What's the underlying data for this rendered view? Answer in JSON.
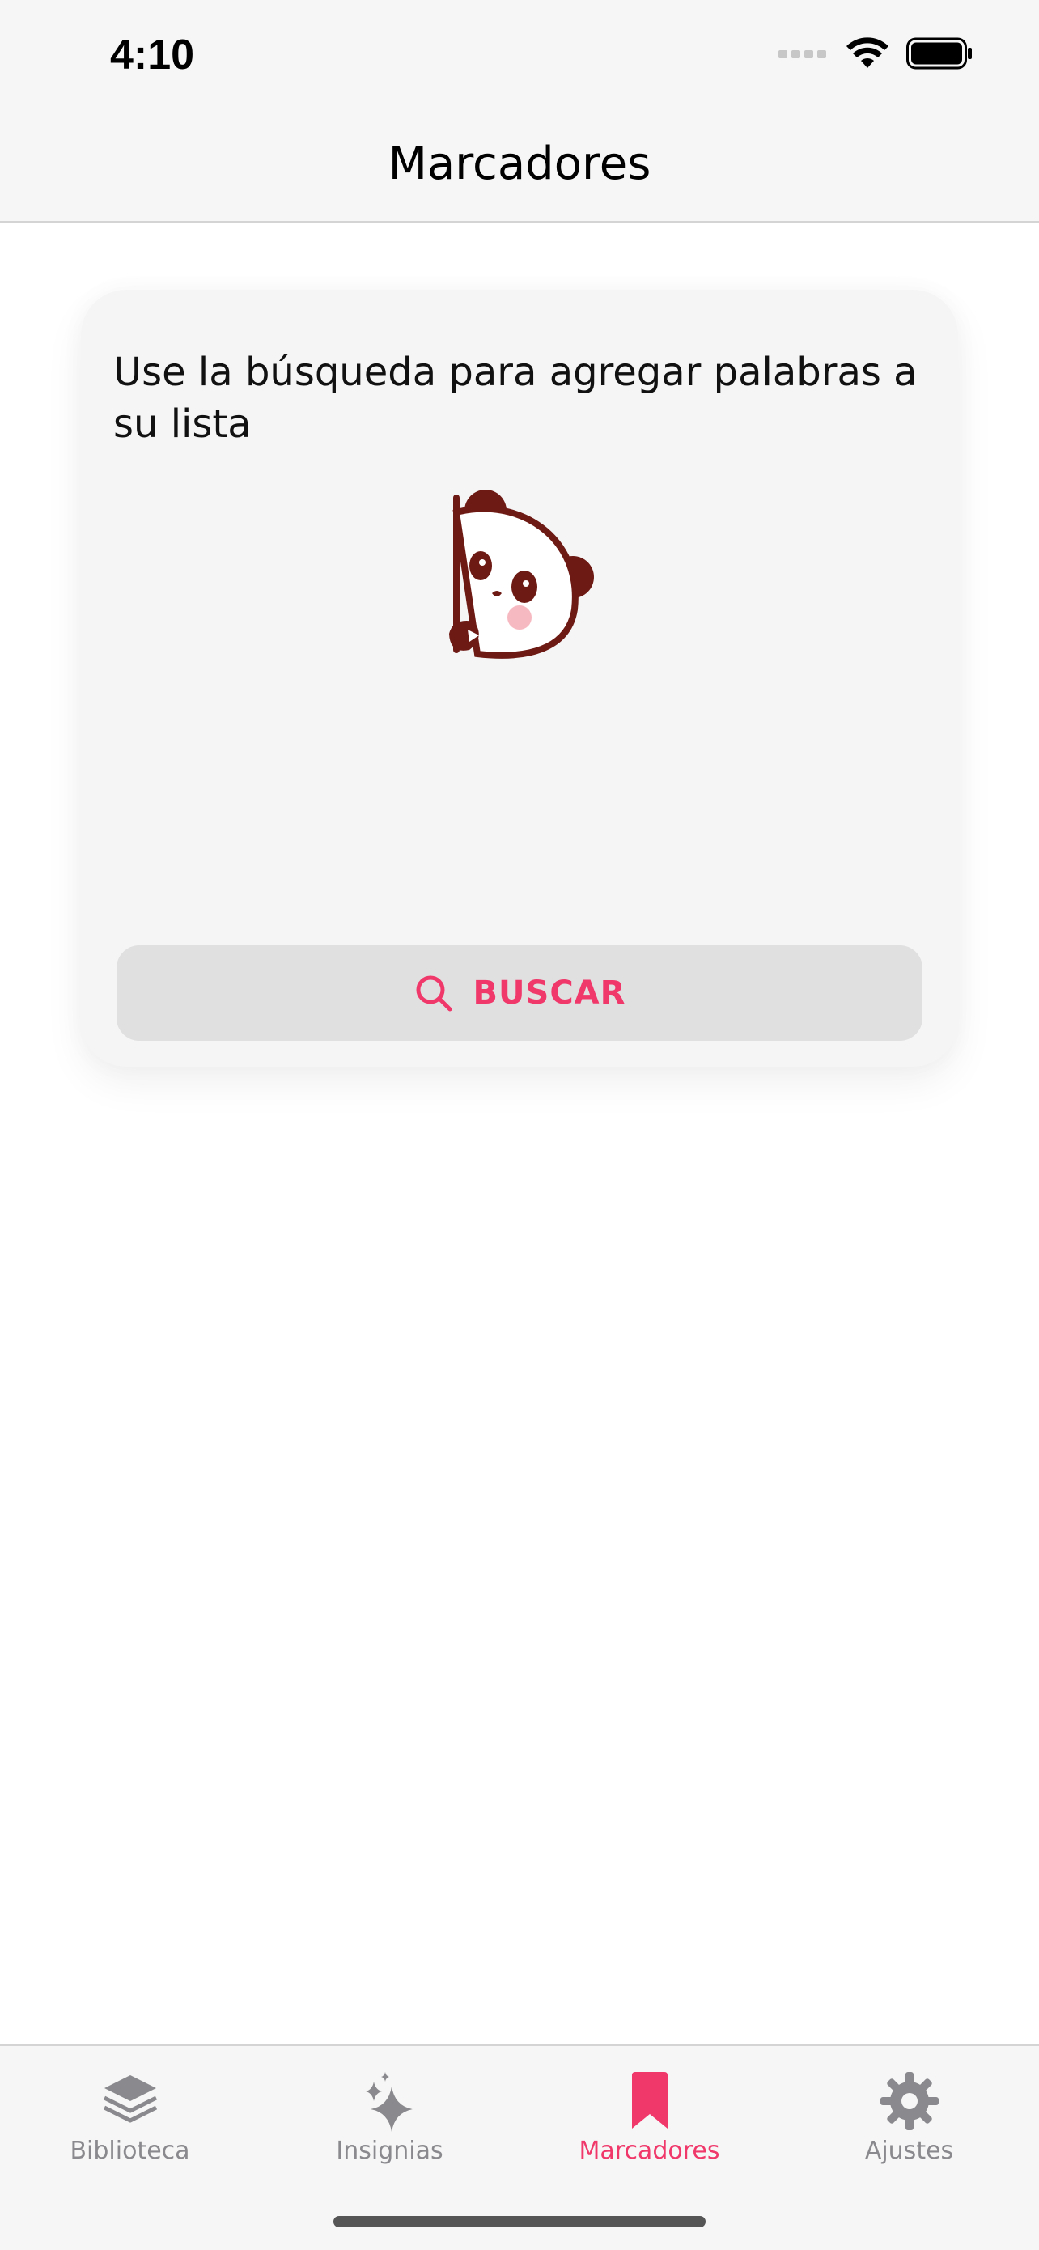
{
  "status_bar": {
    "time": "4:10"
  },
  "nav": {
    "title": "Marcadores"
  },
  "card": {
    "message": "Use la búsqueda para agregar palabras a su lista",
    "search_button_label": "BUSCAR",
    "search_icon": "search-icon",
    "illustration": "panda-peeking"
  },
  "tabs": [
    {
      "label": "Biblioteca",
      "icon": "stack-icon",
      "active": false
    },
    {
      "label": "Insignias",
      "icon": "sparkles-icon",
      "active": false
    },
    {
      "label": "Marcadores",
      "icon": "bookmark-icon",
      "active": true
    },
    {
      "label": "Ajustes",
      "icon": "gear-icon",
      "active": false
    }
  ],
  "colors": {
    "accent": "#f0386b",
    "inactive": "#8a8a8e",
    "panda": "#6e1a14",
    "blush": "#f7b9c1"
  }
}
